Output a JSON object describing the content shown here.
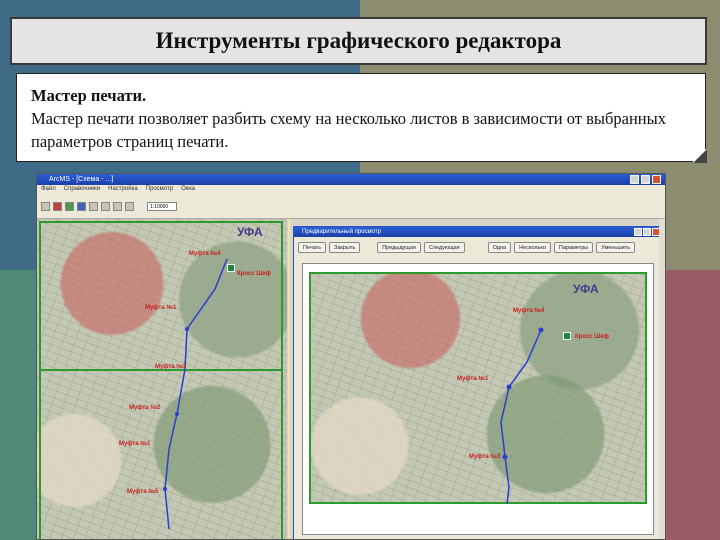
{
  "slide": {
    "title": "Инструменты графического редактора",
    "heading": "Мастер печати.",
    "body": "Мастер печати позволяет разбить схему на несколько листов в зависимости от выбранных параметров страниц печати."
  },
  "app": {
    "title": "ArcMS - [Схема - ...]",
    "menu": [
      "Файл",
      "Справочники",
      "Настройка",
      "Просмотр",
      "Окна"
    ],
    "zoom": "1:10000",
    "map_labels": {
      "city": "УФА",
      "mufta4": "Муфта №4",
      "uzel": "Кросс Шеф",
      "mufta1": "Муфта №1",
      "mufta3": "Муфта №3",
      "mufta2": "Муфта №2",
      "mufta5": "Муфта №5"
    }
  },
  "dialog": {
    "title": "Предварительный просмотр",
    "buttons": {
      "print": "Печать",
      "close": "Закрыть",
      "prev": "Предыдущая",
      "next": "Следующая",
      "one_page": "Одна",
      "two_pages": "Несколько",
      "setup": "Параметры",
      "shrink": "Уменьшить"
    },
    "map_labels": {
      "city": "УФА",
      "mufta4": "Муфта №4",
      "uzel": "Кросс Шеф",
      "mufta1": "Муфта №1",
      "mufta3": "Муфта №3"
    }
  },
  "colors": {
    "frame_green": "#2c9a2c",
    "route_blue": "#2a3fd0",
    "label_red": "#c81e1e"
  }
}
